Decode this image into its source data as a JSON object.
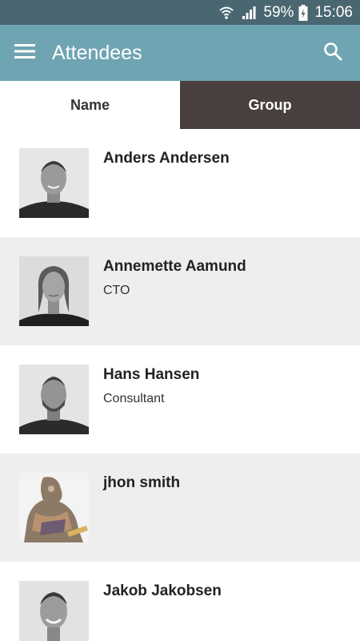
{
  "status_bar": {
    "battery_percent": "59%",
    "time": "15:06",
    "icons": [
      "wifi-icon",
      "signal-icon",
      "battery-charging-icon"
    ]
  },
  "app_bar": {
    "title": "Attendees",
    "icons": [
      "menu-icon",
      "search-icon"
    ]
  },
  "tabs": [
    {
      "label": "Name",
      "selected": false
    },
    {
      "label": "Group",
      "selected": true
    }
  ],
  "attendees": [
    {
      "name": "Anders Andersen",
      "role": ""
    },
    {
      "name": "Annemette Aamund",
      "role": "CTO"
    },
    {
      "name": "Hans Hansen",
      "role": "Consultant"
    },
    {
      "name": "jhon smith",
      "role": ""
    },
    {
      "name": "Jakob Jakobsen",
      "role": ""
    }
  ],
  "colors": {
    "status_bar": "#4a6771",
    "app_bar": "#6fa4b2",
    "tab_selected": "#4a3f3f",
    "row_alt": "#eeeeee"
  }
}
